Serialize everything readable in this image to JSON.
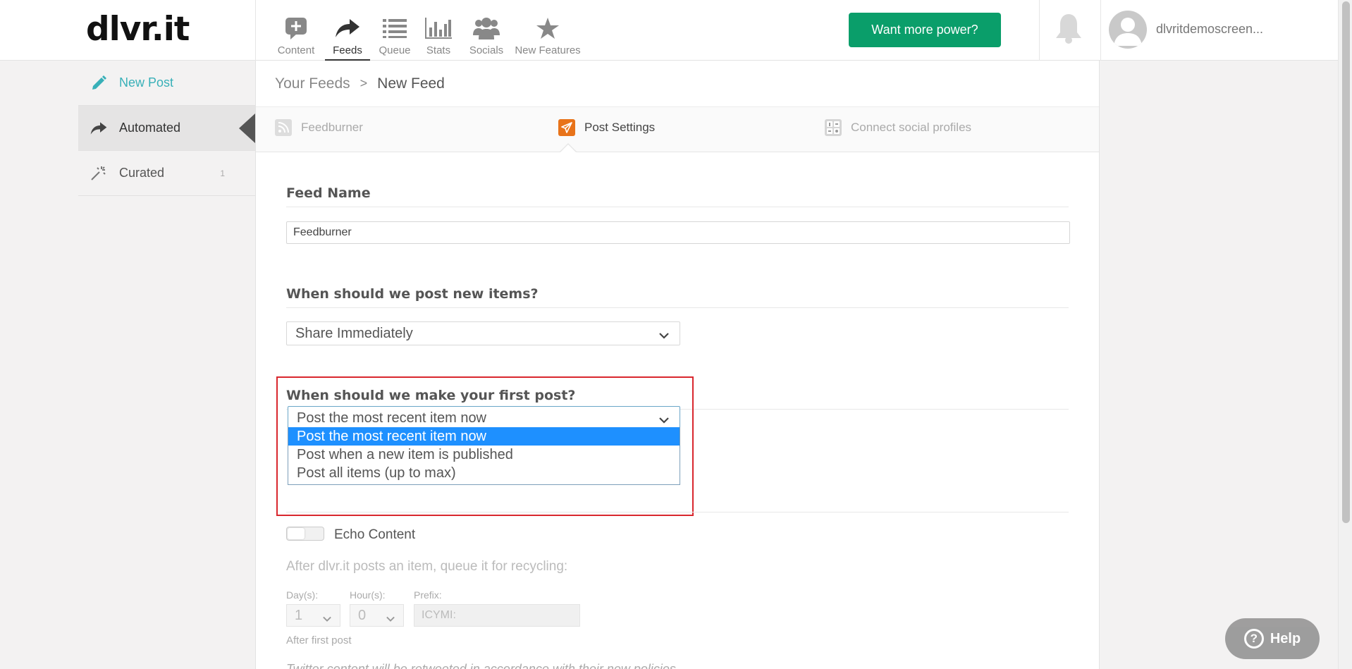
{
  "header": {
    "logo": "dlvr.it",
    "nav": [
      {
        "label": "Content",
        "icon": "plus-comment-icon"
      },
      {
        "label": "Feeds",
        "icon": "share-arrow-icon",
        "active": true
      },
      {
        "label": "Queue",
        "icon": "list-icon"
      },
      {
        "label": "Stats",
        "icon": "bar-chart-icon"
      },
      {
        "label": "Socials",
        "icon": "people-icon"
      },
      {
        "label": "New Features",
        "icon": "star-icon"
      }
    ],
    "power_button": "Want more power?",
    "username": "dlvritdemoscreen..."
  },
  "sidebar": {
    "items": [
      {
        "label": "New Post",
        "icon": "pencil-icon"
      },
      {
        "label": "Automated",
        "icon": "share-arrow-icon"
      },
      {
        "label": "Curated",
        "icon": "magic-wand-icon",
        "badge": "1"
      }
    ]
  },
  "breadcrumb": {
    "parent": "Your Feeds",
    "separator": ">",
    "current": "New Feed"
  },
  "steps": [
    {
      "label": "Feedburner",
      "icon": "rss-icon"
    },
    {
      "label": "Post Settings",
      "icon": "paper-plane-icon",
      "active": true
    },
    {
      "label": "Connect social profiles",
      "icon": "social-grid-icon"
    }
  ],
  "form": {
    "feed_name_title": "Feed Name",
    "feed_name_value": "Feedburner",
    "post_new_title": "When should we post new items?",
    "post_new_value": "Share Immediately",
    "first_post_title": "When should we make your first post?",
    "first_post_value": "Post the most recent item now",
    "first_post_options": [
      "Post the most recent item now",
      "Post when a new item is published",
      "Post all items (up to max)"
    ],
    "echo_label": "Echo Content",
    "recycle_text": "After dlvr.it posts an item, queue it for recycling:",
    "days_label": "Day(s):",
    "days_value": "1",
    "hours_label": "Hour(s):",
    "hours_value": "0",
    "prefix_label": "Prefix:",
    "prefix_placeholder": "ICYMI:",
    "after_first": "After first post",
    "twitter_note": "Twitter content will be retweeted in accordance with their new policies."
  },
  "help": {
    "label": "Help"
  },
  "colors": {
    "accent": "#0a9e6a",
    "teal": "#38b0b8",
    "orange": "#e8731a",
    "highlight": "#d9272e",
    "option_selected": "#1e90ff"
  }
}
